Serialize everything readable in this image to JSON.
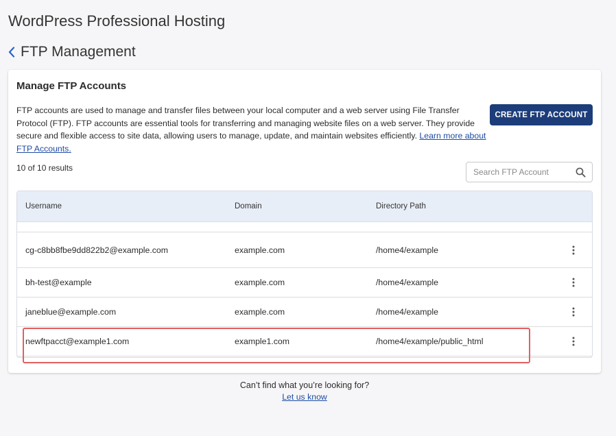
{
  "page": {
    "title": "WordPress Professional Hosting",
    "subtitle": "FTP Management"
  },
  "card": {
    "title": "Manage FTP Accounts",
    "description": "FTP accounts are used to manage and transfer files between your local computer and a web server using File Transfer Protocol (FTP). FTP accounts are essential tools for transferring and managing website files on a web server. They provide secure and flexible access to site data, allowing users to manage, update, and maintain websites efficiently. ",
    "learn_more": "Learn more about FTP Accounts.",
    "create_button": "CREATE FTP ACCOUNT",
    "results": "10 of 10 results",
    "search_placeholder": "Search FTP Account"
  },
  "table": {
    "headers": {
      "username": "Username",
      "domain": "Domain",
      "directory": "Directory Path"
    },
    "rows": [
      {
        "username": "cg-c8bb8fbe9dd822b2@example.com",
        "domain": "example.com",
        "directory": "/home4/example"
      },
      {
        "username": "bh-test@example",
        "domain": "example.com",
        "directory": "/home4/example"
      },
      {
        "username": "janeblue@example.com",
        "domain": "example.com",
        "directory": "/home4/example"
      },
      {
        "username": "newftpacct@example1.com",
        "domain": "example1.com",
        "directory": "/home4/example/public_html"
      }
    ]
  },
  "footer": {
    "question": "Can’t find what you’re looking for?",
    "link": "Let us know"
  },
  "colors": {
    "accent": "#1c3d7a",
    "link": "#1d4ba2",
    "header_bg": "#e8eef8",
    "highlight": "#e06060"
  },
  "icons": {
    "back": "chevron-left-icon",
    "search": "search-icon",
    "row_menu": "kebab-menu-icon"
  }
}
